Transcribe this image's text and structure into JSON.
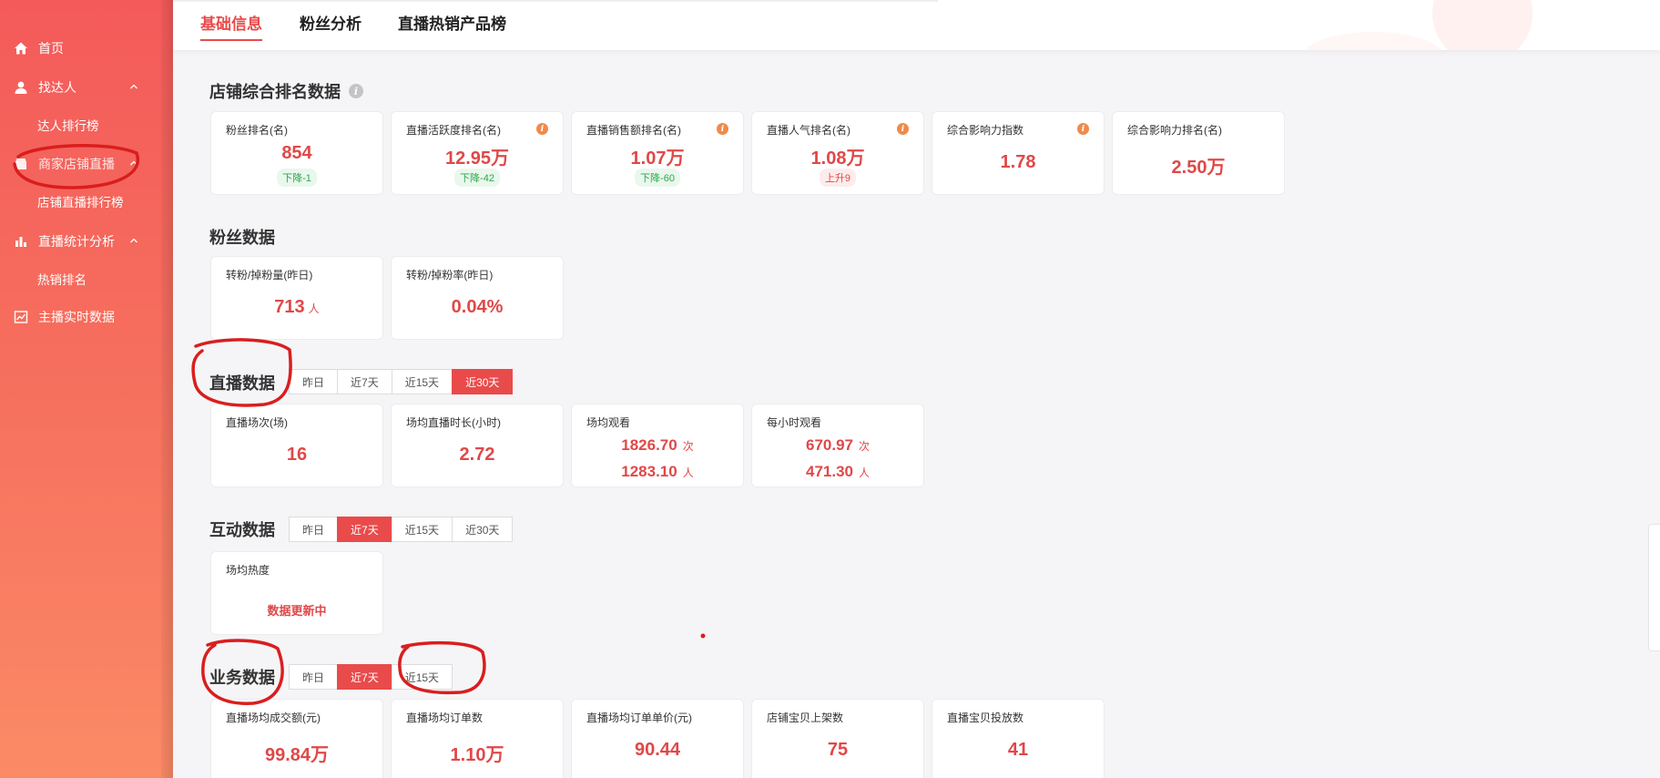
{
  "sidebar": {
    "items": [
      {
        "label": "首页",
        "icon": "home-icon"
      },
      {
        "label": "找达人",
        "icon": "user-icon",
        "sub": [
          "达人排行榜"
        ]
      },
      {
        "label": "商家店铺直播",
        "icon": "store-icon",
        "sub": [
          "店铺直播排行榜"
        ]
      },
      {
        "label": "直播统计分析",
        "icon": "bar-chart-icon",
        "sub": [
          "热销排名"
        ]
      },
      {
        "label": "主播实时数据",
        "icon": "trend-chart-icon"
      }
    ]
  },
  "tabs": [
    "基础信息",
    "粉丝分析",
    "直播热销产品榜"
  ],
  "ranking": {
    "title": "店铺综合排名数据",
    "cards": [
      {
        "label": "粉丝排名(名)",
        "value": "854",
        "badge": "下降-1",
        "trend": "down"
      },
      {
        "label": "直播活跃度排名(名)",
        "value": "12.95万",
        "badge": "下降-42",
        "trend": "down"
      },
      {
        "label": "直播销售额排名(名)",
        "value": "1.07万",
        "badge": "下降-60",
        "trend": "down"
      },
      {
        "label": "直播人气排名(名)",
        "value": "1.08万",
        "badge": "上升9",
        "trend": "up"
      },
      {
        "label": "综合影响力指数",
        "value": "1.78"
      },
      {
        "label": "综合影响力排名(名)",
        "value": "2.50万"
      }
    ]
  },
  "fans": {
    "title": "粉丝数据",
    "cards": [
      {
        "label": "转粉/掉粉量(昨日)",
        "value": "713",
        "unit": "人"
      },
      {
        "label": "转粉/掉粉率(昨日)",
        "value": "0.04%"
      }
    ]
  },
  "live": {
    "title": "直播数据",
    "filters": [
      "昨日",
      "近7天",
      "近15天",
      "近30天"
    ],
    "selected": "近30天",
    "cards": [
      {
        "label": "直播场次(场)",
        "value": "16"
      },
      {
        "label": "场均直播时长(小时)",
        "value": "2.72"
      },
      {
        "label": "场均观看",
        "v1": "1826.70",
        "u1": "次",
        "v2": "1283.10",
        "u2": "人"
      },
      {
        "label": "每小时观看",
        "v1": "670.97",
        "u1": "次",
        "v2": "471.30",
        "u2": "人"
      }
    ]
  },
  "interact": {
    "title": "互动数据",
    "filters": [
      "昨日",
      "近7天",
      "近15天",
      "近30天"
    ],
    "selected": "近7天",
    "cards": [
      {
        "label": "场均热度",
        "status": "数据更新中"
      }
    ]
  },
  "business": {
    "title": "业务数据",
    "filters": [
      "昨日",
      "近7天",
      "近15天"
    ],
    "selected": "近7天",
    "cards": [
      {
        "label": "直播场均成交额(元)",
        "value": "99.84万"
      },
      {
        "label": "直播场均订单数",
        "value": "1.10万"
      },
      {
        "label": "直播场均订单单价(元)",
        "value": "90.44"
      },
      {
        "label": "店铺宝贝上架数",
        "value": "75"
      },
      {
        "label": "直播宝贝投放数",
        "value": "41"
      }
    ]
  },
  "colors": {
    "accent": "#e94b4b",
    "sidebar_top": "#f45a5a",
    "sidebar_bottom": "#fb8a66",
    "down": "#2ba84a",
    "annotation": "#d91e1e"
  }
}
